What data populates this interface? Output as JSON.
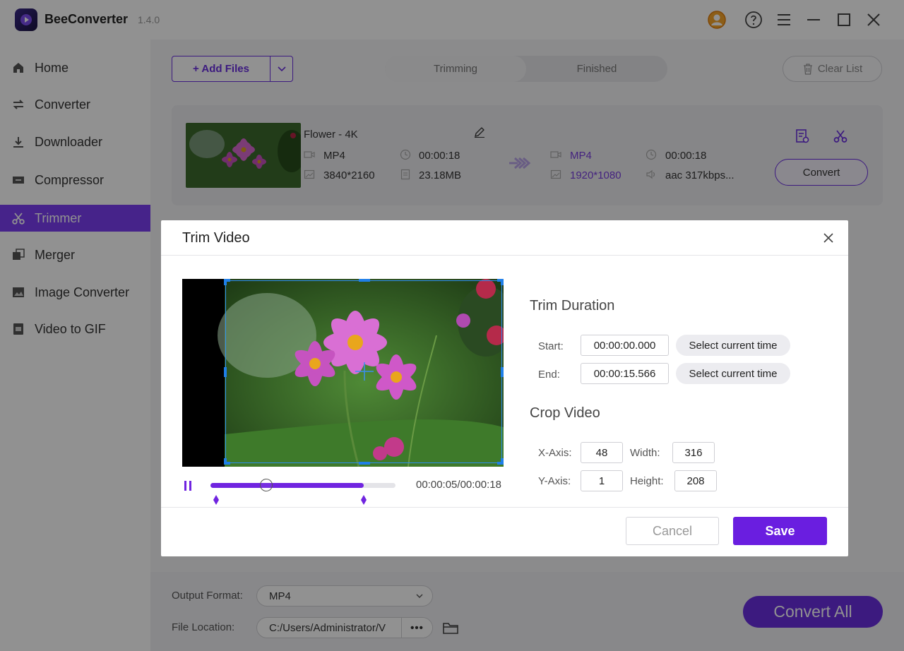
{
  "app": {
    "name": "BeeConverter",
    "version": "1.4.0",
    "icons": [
      "account-icon",
      "help-icon",
      "menu-icon",
      "minimize-icon",
      "maximize-icon",
      "close-icon"
    ]
  },
  "sidebar": {
    "items": [
      {
        "label": "Home",
        "icon": "home-icon"
      },
      {
        "label": "Converter",
        "icon": "converter-icon"
      },
      {
        "label": "Downloader",
        "icon": "download-icon"
      },
      {
        "label": "Compressor",
        "icon": "compress-icon"
      },
      {
        "label": "Trimmer",
        "icon": "scissors-icon",
        "active": true
      },
      {
        "label": "Merger",
        "icon": "merge-icon"
      },
      {
        "label": "Image Converter",
        "icon": "image-icon"
      },
      {
        "label": "Video to GIF",
        "icon": "gif-icon"
      }
    ]
  },
  "toolbar": {
    "add_files": "+ Add Files",
    "tabs": [
      "Trimming",
      "Finished"
    ],
    "active_tab": "Trimming",
    "clear_list": "Clear List"
  },
  "file": {
    "name": "Flower - 4K",
    "src_format": "MP4",
    "src_duration": "00:00:18",
    "src_resolution": "3840*2160",
    "src_size": "23.18MB",
    "out_format": "MP4",
    "out_duration": "00:00:18",
    "out_resolution": "1920*1080",
    "out_audio": "aac 317kbps...",
    "convert_label": "Convert"
  },
  "bottom": {
    "output_format_label": "Output Format:",
    "output_format_value": "MP4",
    "file_location_label": "File Location:",
    "file_location_value": "C:/Users/Administrator/V",
    "more_label": "•••",
    "convert_all": "Convert All"
  },
  "modal": {
    "title": "Trim Video",
    "playback": {
      "current": "00:00:05",
      "separator": "/",
      "total": "00:00:18",
      "progress": 0.83,
      "playhead": 0.3,
      "trim_start": 0.03,
      "trim_end": 0.83
    },
    "trim": {
      "title": "Trim Duration",
      "start_label": "Start:",
      "start_value": "00:00:00.000",
      "end_label": "End:",
      "end_value": "00:00:15.566",
      "select_current": "Select current time"
    },
    "crop": {
      "title": "Crop Video",
      "x_label": "X-Axis:",
      "x_value": "48",
      "y_label": "Y-Axis:",
      "y_value": "1",
      "width_label": "Width:",
      "width_value": "316",
      "height_label": "Height:",
      "height_value": "208"
    },
    "cancel": "Cancel",
    "save": "Save"
  },
  "colors": {
    "accent": "#6a2ee0",
    "active_nav": "#7b3ff2",
    "crop_border": "#2f8ff0"
  }
}
